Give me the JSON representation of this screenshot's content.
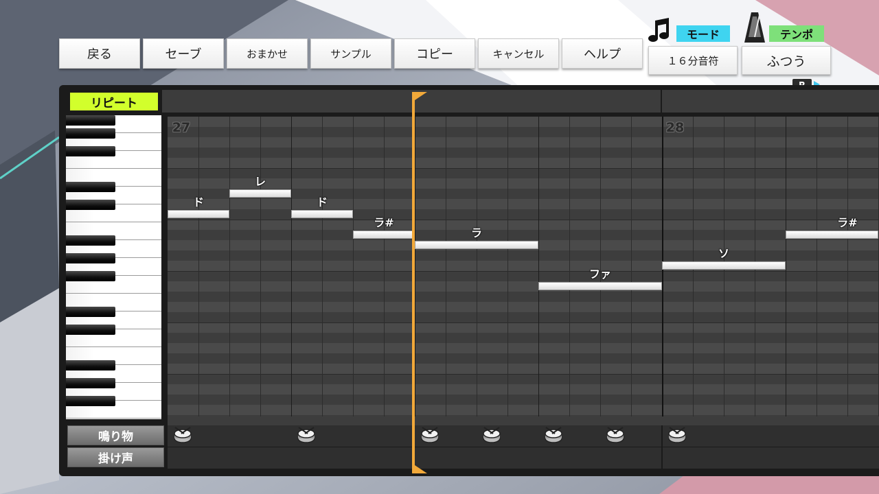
{
  "toolbar": {
    "back": "戻る",
    "save": "セーブ",
    "auto": "おまかせ",
    "sample": "サンプル",
    "copy": "コピー",
    "cancel": "キャンセル",
    "help": "ヘルプ"
  },
  "mode": {
    "label": "モード",
    "value": "１６分音符",
    "icon": "music-note-icon"
  },
  "tempo": {
    "label": "テンポ",
    "value": "ふつう",
    "icon": "metronome-icon"
  },
  "shortcut_key": "R",
  "repeat_label": "リピート",
  "measures": [
    "27",
    "28"
  ],
  "notes": [
    {
      "label": "ド",
      "start_step": 0,
      "length_steps": 2,
      "row": 9
    },
    {
      "label": "レ",
      "start_step": 2,
      "length_steps": 2,
      "row": 7
    },
    {
      "label": "ド",
      "start_step": 4,
      "length_steps": 2,
      "row": 9
    },
    {
      "label": "ラ#",
      "start_step": 6,
      "length_steps": 2,
      "row": 11
    },
    {
      "label": "ラ",
      "start_step": 8,
      "length_steps": 4,
      "row": 12
    },
    {
      "label": "ファ",
      "start_step": 12,
      "length_steps": 4,
      "row": 16
    },
    {
      "label": "ソ",
      "start_step": 16,
      "length_steps": 4,
      "row": 14
    },
    {
      "label": "ラ#",
      "start_step": 20,
      "length_steps": 3,
      "row": 11
    }
  ],
  "rows": {
    "sound": "鳴り物",
    "voice": "掛け声"
  },
  "drum_steps": [
    0,
    4,
    8,
    10,
    12,
    14,
    16
  ],
  "colors": {
    "repeat": "#d2ff2c",
    "mode_badge": "#3fd4f0",
    "tempo_badge": "#7ee07a",
    "playhead": "#f2a93a"
  }
}
